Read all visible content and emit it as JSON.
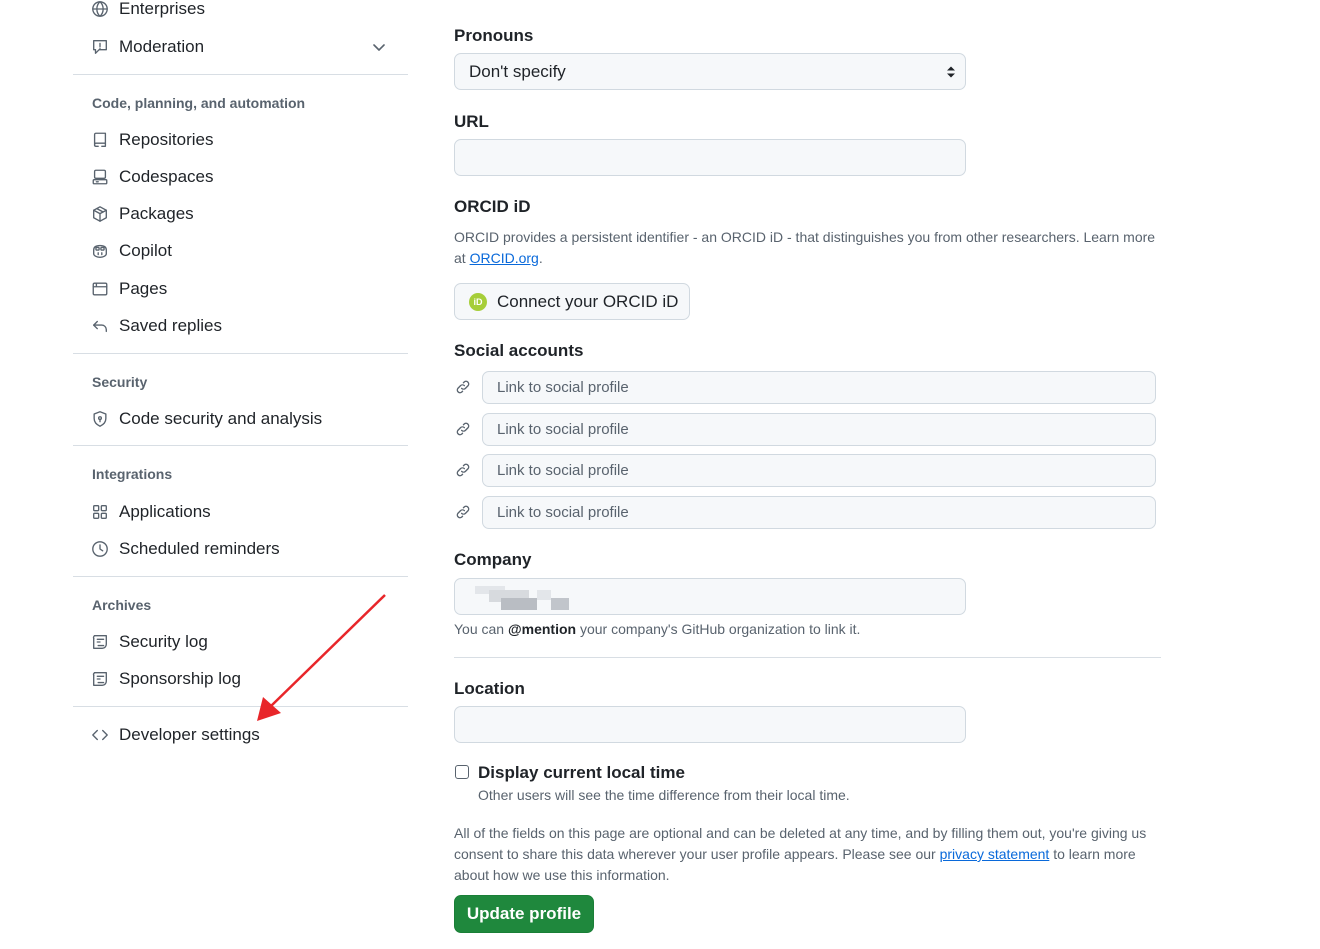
{
  "sidebar": {
    "top_items": [
      {
        "label": "Enterprises",
        "icon": "globe-icon"
      },
      {
        "label": "Moderation",
        "icon": "report-icon"
      }
    ],
    "groups": [
      {
        "heading": "Code, planning, and automation",
        "items": [
          {
            "label": "Repositories",
            "icon": "repo-icon"
          },
          {
            "label": "Codespaces",
            "icon": "codespaces-icon"
          },
          {
            "label": "Packages",
            "icon": "package-icon"
          },
          {
            "label": "Copilot",
            "icon": "copilot-icon"
          },
          {
            "label": "Pages",
            "icon": "browser-icon"
          },
          {
            "label": "Saved replies",
            "icon": "reply-icon"
          }
        ]
      },
      {
        "heading": "Security",
        "items": [
          {
            "label": "Code security and analysis",
            "icon": "shield-lock-icon"
          }
        ]
      },
      {
        "heading": "Integrations",
        "items": [
          {
            "label": "Applications",
            "icon": "apps-icon"
          },
          {
            "label": "Scheduled reminders",
            "icon": "clock-icon"
          }
        ]
      },
      {
        "heading": "Archives",
        "items": [
          {
            "label": "Security log",
            "icon": "log-icon"
          },
          {
            "label": "Sponsorship log",
            "icon": "log-icon"
          }
        ]
      }
    ],
    "bottom_item": {
      "label": "Developer settings",
      "icon": "code-icon"
    }
  },
  "profile_form": {
    "pronouns": {
      "label": "Pronouns",
      "value": "Don't specify"
    },
    "url": {
      "label": "URL",
      "value": ""
    },
    "orcid": {
      "label": "ORCID iD",
      "description": "ORCID provides a persistent identifier - an ORCID iD - that distinguishes you from other researchers. Learn more at",
      "link_text": "ORCID.org",
      "after_link": ".",
      "button_label": "Connect your ORCID iD",
      "logo_text": "iD"
    },
    "social": {
      "label": "Social accounts",
      "placeholders": [
        "Link to social profile",
        "Link to social profile",
        "Link to social profile",
        "Link to social profile"
      ]
    },
    "company": {
      "label": "Company",
      "hint_prefix": "You can",
      "hint_mention": "@mention",
      "hint_suffix": "your company's GitHub organization to link it."
    },
    "location": {
      "label": "Location",
      "value": ""
    },
    "local_time": {
      "label": "Display current local time",
      "hint": "Other users will see the time difference from their local time.",
      "checked": false
    },
    "notice": {
      "text": "All of the fields on this page are optional and can be deleted at any time, and by filling them out, you're giving us consent to share this data wherever your user profile appears. Please see our",
      "link_text": "privacy statement",
      "after_link": "to learn more about how we use this information."
    },
    "submit_label": "Update profile"
  },
  "colors": {
    "primary_button": "#1f883d",
    "link": "#0969da",
    "annotation_arrow": "#e8262a",
    "orcid_green": "#a6ce39"
  }
}
